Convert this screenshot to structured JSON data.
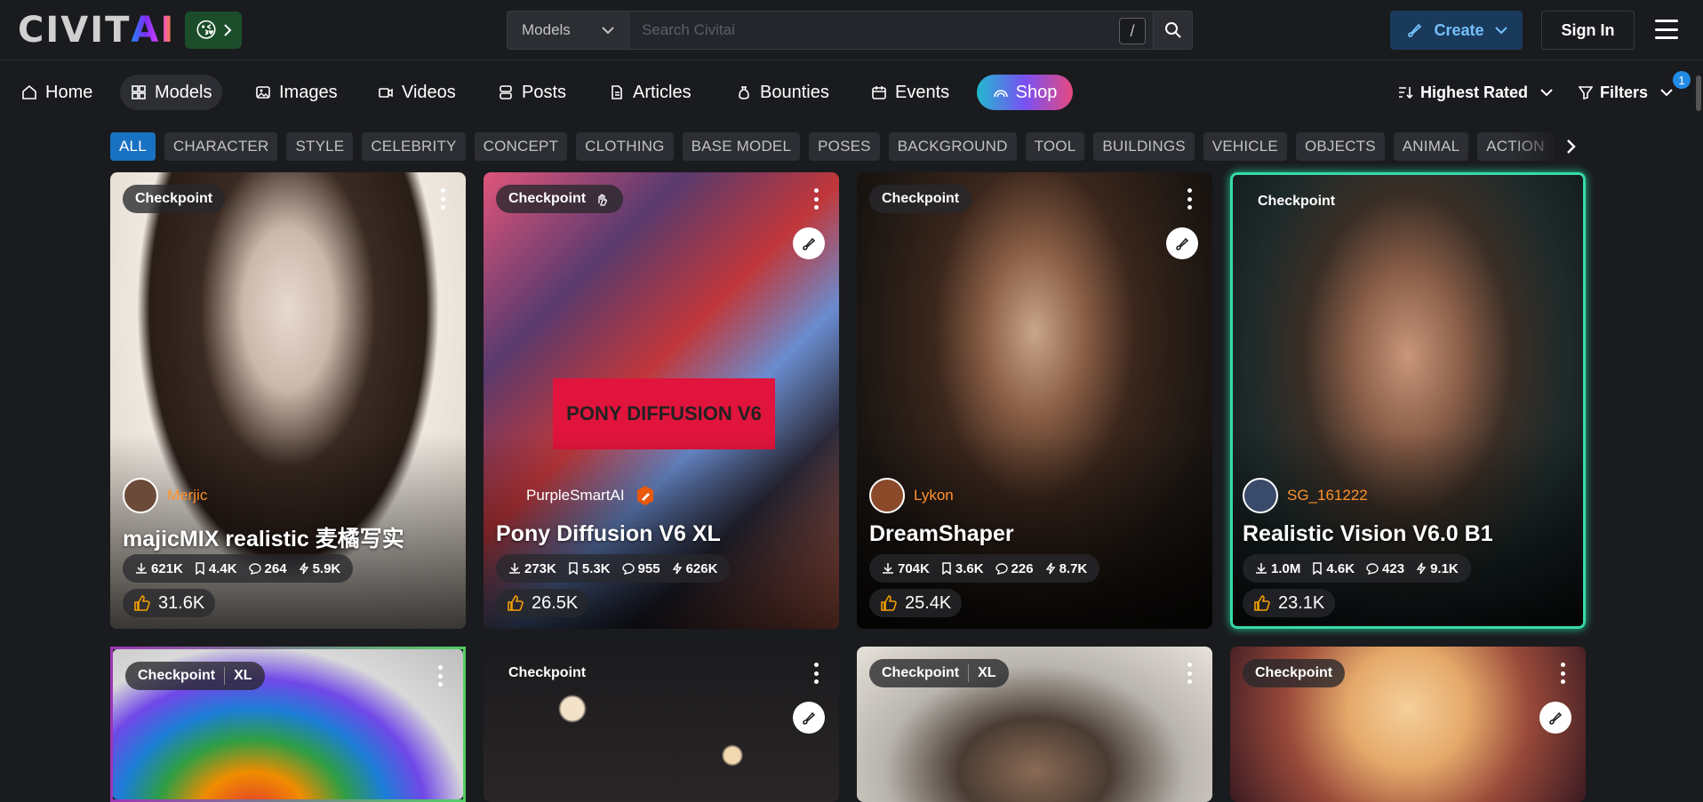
{
  "header": {
    "logo_text": "CIVIT",
    "logo_ai": "AI",
    "emoji": "😘",
    "search_category": "Models",
    "search_placeholder": "Search Civitai",
    "slash_key": "/",
    "create_label": "Create",
    "signin_label": "Sign In"
  },
  "nav": {
    "items": [
      {
        "label": "Home",
        "icon": "home-icon"
      },
      {
        "label": "Models",
        "icon": "grid-icon"
      },
      {
        "label": "Images",
        "icon": "image-icon"
      },
      {
        "label": "Videos",
        "icon": "video-icon"
      },
      {
        "label": "Posts",
        "icon": "posts-icon"
      },
      {
        "label": "Articles",
        "icon": "article-icon"
      },
      {
        "label": "Bounties",
        "icon": "moneybag-icon"
      },
      {
        "label": "Events",
        "icon": "calendar-icon"
      }
    ],
    "shop_label": "Shop",
    "sort_label": "Highest Rated",
    "filters_label": "Filters",
    "filters_count": "1"
  },
  "categories": [
    "ALL",
    "CHARACTER",
    "STYLE",
    "CELEBRITY",
    "CONCEPT",
    "CLOTHING",
    "BASE MODEL",
    "POSES",
    "BACKGROUND",
    "TOOL",
    "BUILDINGS",
    "VEHICLE",
    "OBJECTS",
    "ANIMAL",
    "ACTION"
  ],
  "cards": [
    {
      "type": "Checkpoint",
      "creator": "Merjic",
      "title": "majicMIX realistic 麦橘写实",
      "downloads": "621K",
      "saves": "4.4K",
      "comments": "264",
      "buzz": "5.9K",
      "likes": "31.6K"
    },
    {
      "type": "Checkpoint",
      "creator": "PurpleSmartAI",
      "title": "Pony Diffusion V6 XL",
      "downloads": "273K",
      "saves": "5.3K",
      "comments": "955",
      "buzz": "626K",
      "likes": "26.5K",
      "art_text": "PONY DIFFUSION V6"
    },
    {
      "type": "Checkpoint",
      "creator": "Lykon",
      "title": "DreamShaper",
      "downloads": "704K",
      "saves": "3.6K",
      "comments": "226",
      "buzz": "8.7K",
      "likes": "25.4K"
    },
    {
      "type": "Checkpoint",
      "creator": "SG_161222",
      "title": "Realistic Vision V6.0 B1",
      "downloads": "1.0M",
      "saves": "4.6K",
      "comments": "423",
      "buzz": "9.1K",
      "likes": "23.1K"
    }
  ],
  "row2": [
    {
      "type": "Checkpoint",
      "base": "XL"
    },
    {
      "type": "Checkpoint"
    },
    {
      "type": "Checkpoint",
      "base": "XL"
    },
    {
      "type": "Checkpoint"
    }
  ],
  "colors": {
    "accent": "#1971c2",
    "creator": "#ff922b",
    "bg": "#1a1b1e"
  }
}
